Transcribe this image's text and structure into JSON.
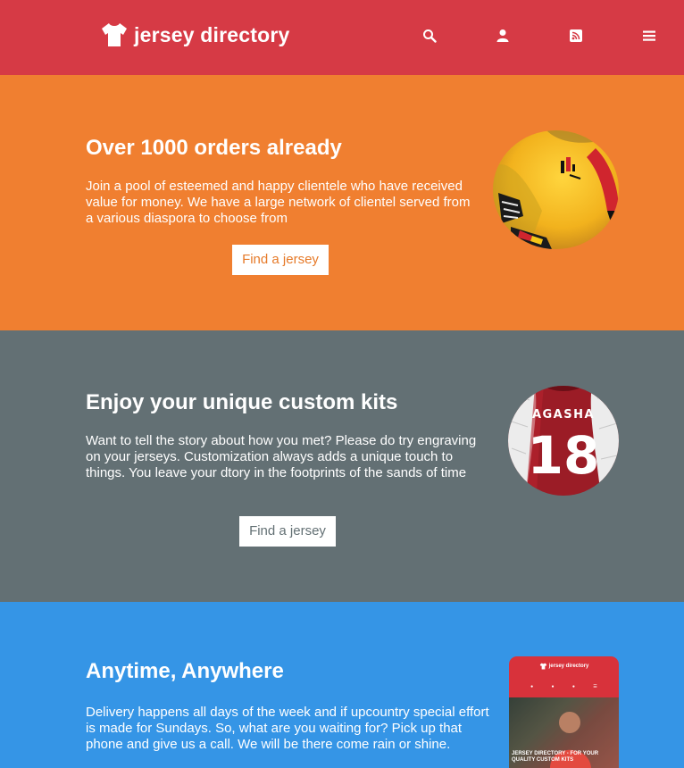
{
  "header": {
    "brand": "jersey directory",
    "icons": [
      "tshirt-icon",
      "search-icon",
      "user-icon",
      "rss-icon",
      "menu-icon"
    ]
  },
  "sections": [
    {
      "bg": "#f07f30",
      "title": "Over 1000 orders already",
      "text": "Join a pool of esteemed and happy clientele who have received value for money. We have a large network of clientel served from a various diaspora to choose from",
      "button": "Find a jersey"
    },
    {
      "bg": "#637074",
      "title": "Enjoy your unique custom kits",
      "text": "Want to tell the story about how you met? Please do try engraving on your jerseys. Customization always adds a unique touch to things. You leave your dtory in the footprints of the sands of time",
      "button": "Find a jersey",
      "jersey_name": "AGASHA",
      "jersey_number": "18"
    },
    {
      "bg": "#3595e6",
      "title": "Anytime, Anywhere",
      "text": "Delivery happens all days of the week and if upcountry special effort is made for Sundays. So, what are you waiting for? Pick up that phone and give us a call. We will be there come rain or shine.",
      "phone": {
        "brand": "jersey directory",
        "caption": "JERSEY DIRECTORY - FOR YOUR QUALITY CUSTOM KITS"
      }
    }
  ],
  "colors": {
    "header": "#d63a45",
    "section1": "#f07f30",
    "section2": "#637074",
    "section3": "#3595e6"
  }
}
